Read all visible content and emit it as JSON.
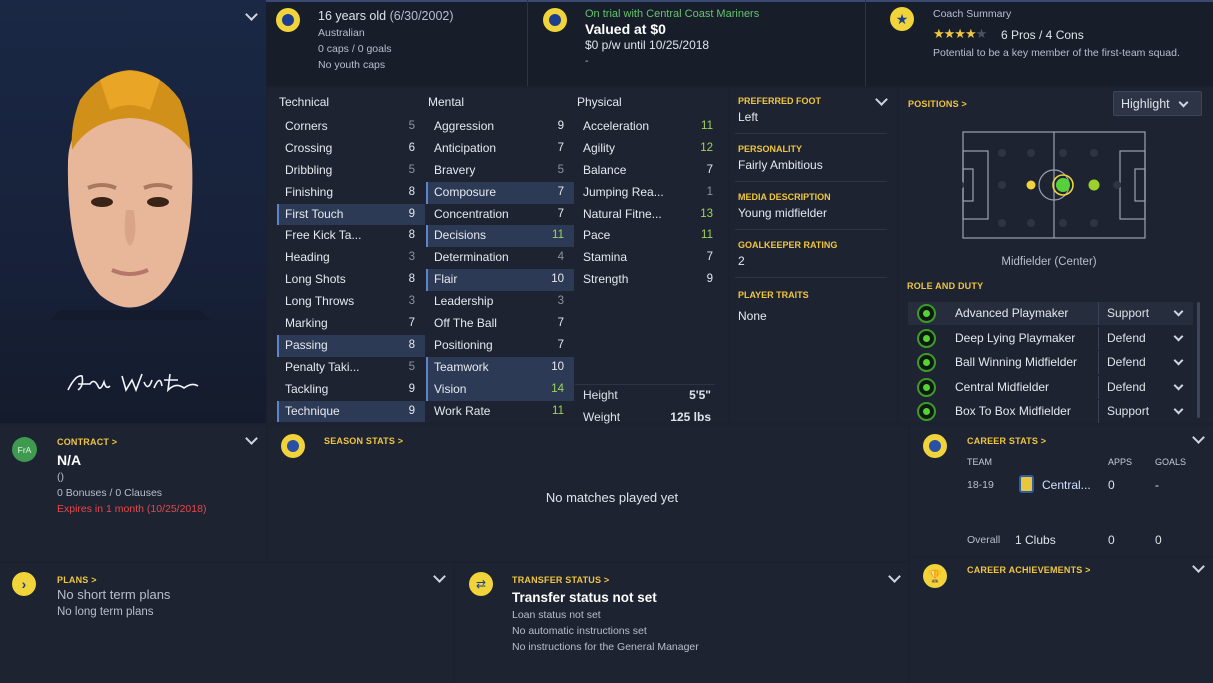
{
  "header": {
    "age": "16 years old",
    "dob": "(6/30/2002)",
    "nationality": "Australian",
    "caps": "0 caps / 0 goals",
    "youth_caps": "No youth caps",
    "trial": "On trial with Central Coast Mariners",
    "value": "Valued at $0",
    "wage": "$0 p/w until 10/25/2018",
    "wage_extra": "-",
    "coach_title": "Coach Summary",
    "pros_cons": "6 Pros / 4 Cons",
    "stars": 4.5,
    "potential": "Potential to be a key member of the first-team squad."
  },
  "technical": {
    "title": "Technical",
    "items": [
      {
        "name": "Corners",
        "value": "5",
        "tone": "lo",
        "hl": false
      },
      {
        "name": "Crossing",
        "value": "6",
        "tone": "",
        "hl": false
      },
      {
        "name": "Dribbling",
        "value": "5",
        "tone": "lo",
        "hl": false
      },
      {
        "name": "Finishing",
        "value": "8",
        "tone": "",
        "hl": false
      },
      {
        "name": "First Touch",
        "value": "9",
        "tone": "",
        "hl": true
      },
      {
        "name": "Free Kick Ta...",
        "value": "8",
        "tone": "",
        "hl": false
      },
      {
        "name": "Heading",
        "value": "3",
        "tone": "lo",
        "hl": false
      },
      {
        "name": "Long Shots",
        "value": "8",
        "tone": "",
        "hl": false
      },
      {
        "name": "Long Throws",
        "value": "3",
        "tone": "lo",
        "hl": false
      },
      {
        "name": "Marking",
        "value": "7",
        "tone": "",
        "hl": false
      },
      {
        "name": "Passing",
        "value": "8",
        "tone": "",
        "hl": true
      },
      {
        "name": "Penalty Taki...",
        "value": "5",
        "tone": "lo",
        "hl": false
      },
      {
        "name": "Tackling",
        "value": "9",
        "tone": "",
        "hl": false
      },
      {
        "name": "Technique",
        "value": "9",
        "tone": "",
        "hl": true
      }
    ]
  },
  "mental": {
    "title": "Mental",
    "items": [
      {
        "name": "Aggression",
        "value": "9",
        "tone": "",
        "hl": false
      },
      {
        "name": "Anticipation",
        "value": "7",
        "tone": "",
        "hl": false
      },
      {
        "name": "Bravery",
        "value": "5",
        "tone": "lo",
        "hl": false
      },
      {
        "name": "Composure",
        "value": "7",
        "tone": "",
        "hl": true
      },
      {
        "name": "Concentration",
        "value": "7",
        "tone": "",
        "hl": false
      },
      {
        "name": "Decisions",
        "value": "11",
        "tone": "hi",
        "hl": true
      },
      {
        "name": "Determination",
        "value": "4",
        "tone": "lo",
        "hl": false
      },
      {
        "name": "Flair",
        "value": "10",
        "tone": "",
        "hl": true
      },
      {
        "name": "Leadership",
        "value": "3",
        "tone": "lo",
        "hl": false
      },
      {
        "name": "Off The Ball",
        "value": "7",
        "tone": "",
        "hl": false
      },
      {
        "name": "Positioning",
        "value": "7",
        "tone": "",
        "hl": false
      },
      {
        "name": "Teamwork",
        "value": "10",
        "tone": "",
        "hl": true
      },
      {
        "name": "Vision",
        "value": "14",
        "tone": "hi",
        "hl": true
      },
      {
        "name": "Work Rate",
        "value": "11",
        "tone": "hi",
        "hl": false
      }
    ]
  },
  "physical": {
    "title": "Physical",
    "items": [
      {
        "name": "Acceleration",
        "value": "11",
        "tone": "hi",
        "hl": false
      },
      {
        "name": "Agility",
        "value": "12",
        "tone": "hi",
        "hl": false
      },
      {
        "name": "Balance",
        "value": "7",
        "tone": "",
        "hl": false
      },
      {
        "name": "Jumping Rea...",
        "value": "1",
        "tone": "lo",
        "hl": false
      },
      {
        "name": "Natural Fitne...",
        "value": "13",
        "tone": "hi",
        "hl": false
      },
      {
        "name": "Pace",
        "value": "11",
        "tone": "hi",
        "hl": false
      },
      {
        "name": "Stamina",
        "value": "7",
        "tone": "",
        "hl": false
      },
      {
        "name": "Strength",
        "value": "9",
        "tone": "",
        "hl": false
      }
    ],
    "height_label": "Height",
    "height": "5'5\"",
    "weight_label": "Weight",
    "weight": "125 lbs"
  },
  "profile": {
    "foot_label": "PREFERRED FOOT",
    "foot": "Left",
    "personality_label": "PERSONALITY",
    "personality": "Fairly Ambitious",
    "media_label": "MEDIA DESCRIPTION",
    "media": "Young midfielder",
    "gk_label": "GOALKEEPER RATING",
    "gk": "2",
    "traits_label": "PLAYER TRAITS",
    "traits": "None"
  },
  "positions": {
    "title": "POSITIONS >",
    "dropdown": "Highlight",
    "position_name": "Midfielder (Center)",
    "role_title": "ROLE AND DUTY",
    "roles": [
      {
        "name": "Advanced Playmaker",
        "duty": "Support"
      },
      {
        "name": "Deep Lying Playmaker",
        "duty": "Defend"
      },
      {
        "name": "Ball Winning Midfielder",
        "duty": "Defend"
      },
      {
        "name": "Central Midfielder",
        "duty": "Defend"
      },
      {
        "name": "Box To Box Midfielder",
        "duty": "Support"
      }
    ]
  },
  "contract": {
    "title": "CONTRACT >",
    "badge": "FrA",
    "value": "N/A",
    "paren": "()",
    "bonuses": "0 Bonuses / 0 Clauses",
    "expires": "Expires in 1 month",
    "expires_date": "(10/25/2018)"
  },
  "season": {
    "title": "SEASON STATS >",
    "empty": "No matches played yet"
  },
  "career": {
    "title": "CAREER STATS >",
    "col_team": "TEAM",
    "col_apps": "APPS",
    "col_goals": "GOALS",
    "season": "18-19",
    "club": "Central...",
    "apps": "0",
    "goals": "-",
    "overall_label": "Overall",
    "overall_clubs": "1 Clubs",
    "overall_apps": "0",
    "overall_goals": "0"
  },
  "plans": {
    "title": "PLANS >",
    "short": "No short term plans",
    "long": "No long term plans"
  },
  "transfer": {
    "title": "TRANSFER STATUS >",
    "status": "Transfer status not set",
    "loan": "Loan status not set",
    "auto": "No automatic instructions set",
    "gm": "No instructions for the General Manager"
  },
  "achievements": {
    "title": "CAREER ACHIEVEMENTS >"
  },
  "colors": {
    "accent_yellow": "#f0c640",
    "high_green": "#9fd45a",
    "expiry_red": "#e6484b"
  }
}
